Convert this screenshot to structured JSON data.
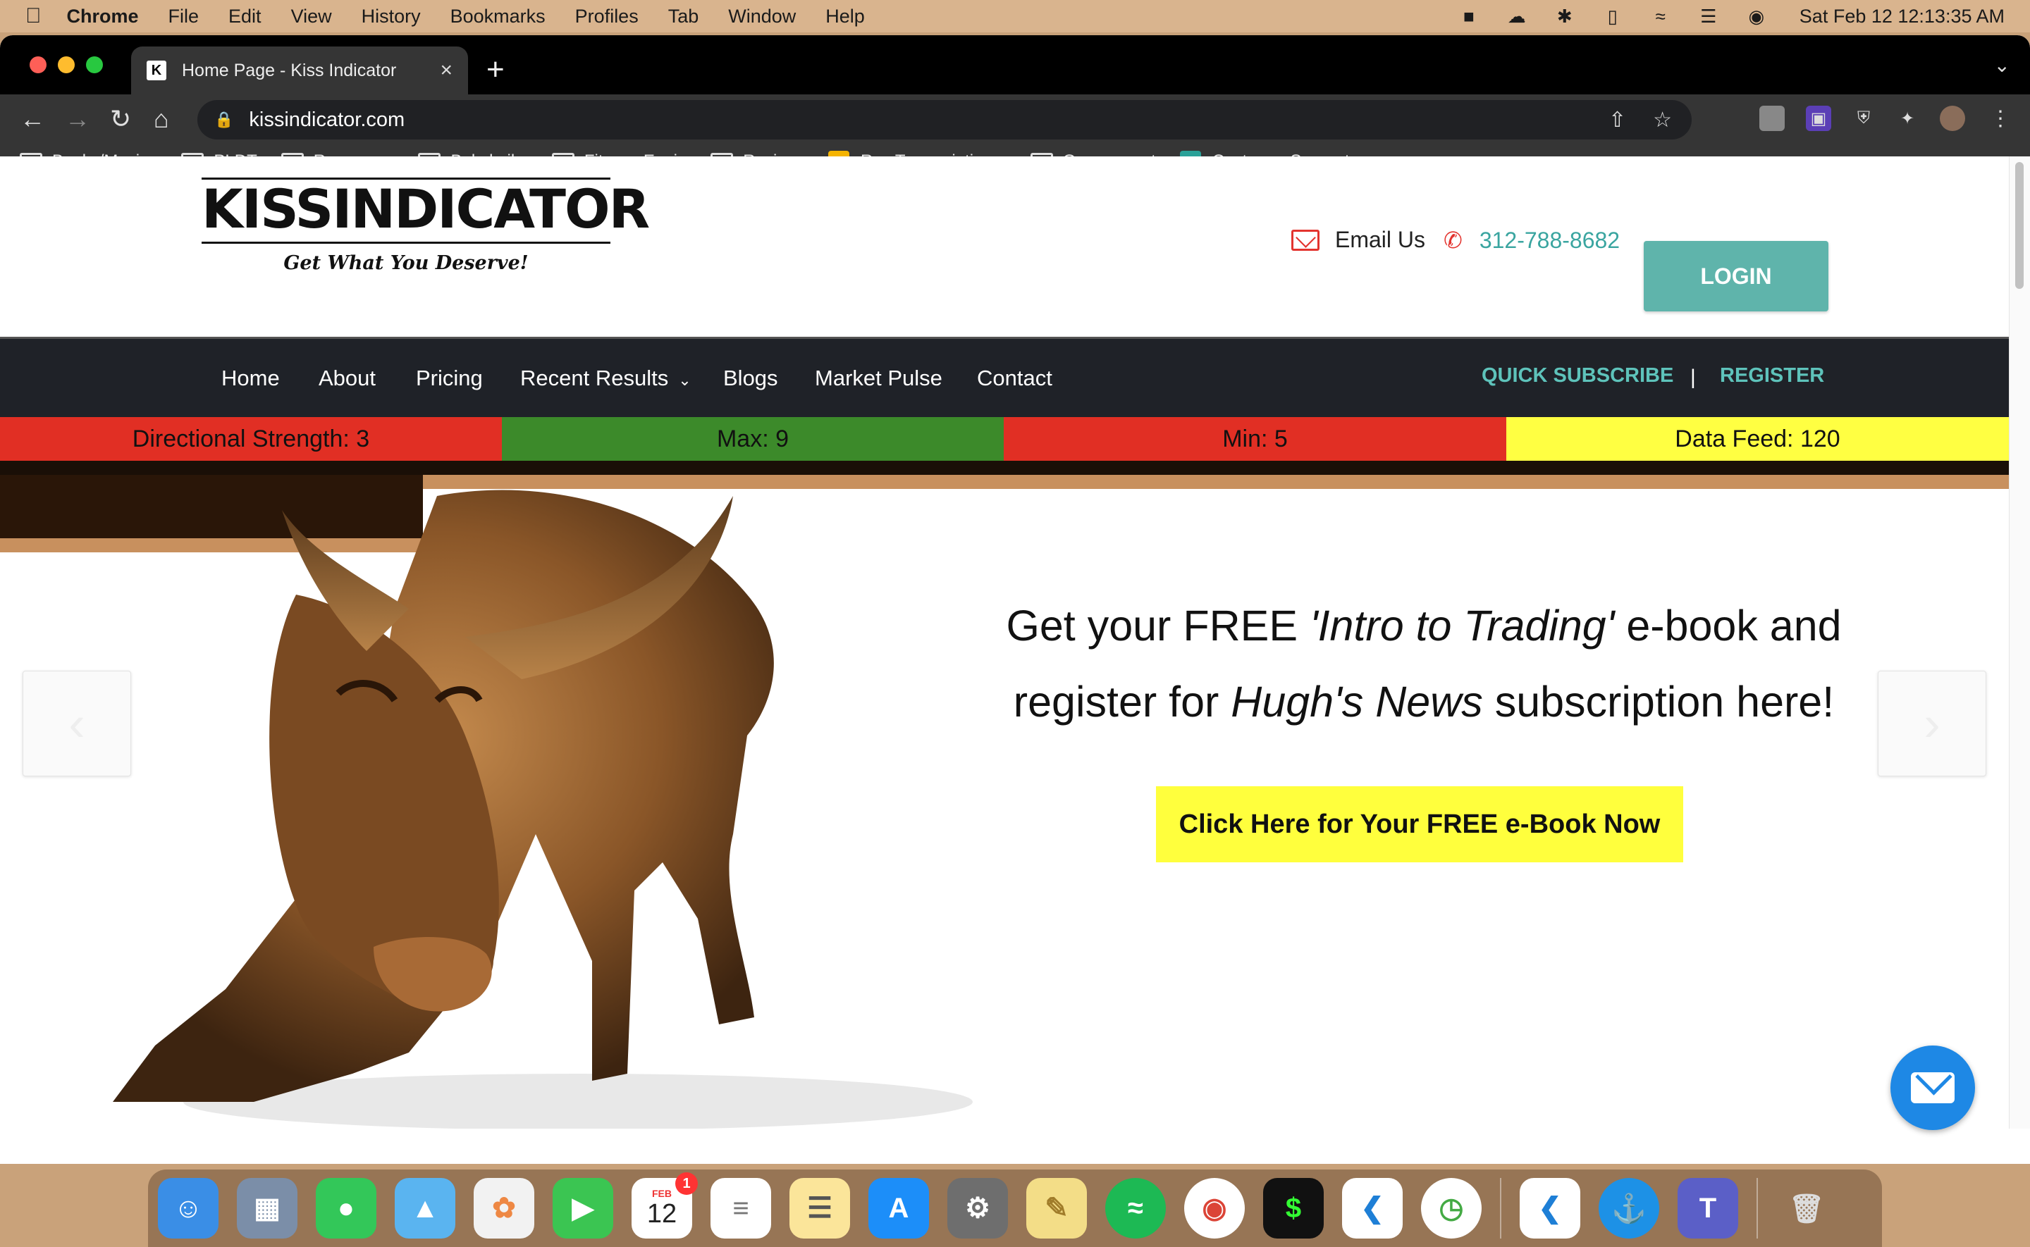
{
  "menubar": {
    "app_name": "Chrome",
    "items": [
      "File",
      "Edit",
      "View",
      "History",
      "Bookmarks",
      "Profiles",
      "Tab",
      "Window",
      "Help"
    ],
    "clock": "Sat Feb 12  12:13:35 AM"
  },
  "browser": {
    "tab_title": "Home Page - Kiss Indicator",
    "favicon_letter": "K",
    "url": "kissindicator.com",
    "bookmarks": [
      {
        "label": "Books/Movies",
        "icon": "folder-icon"
      },
      {
        "label": "PLDT",
        "icon": "folder-icon"
      },
      {
        "label": "Resources",
        "icon": "folder-icon"
      },
      {
        "label": "Babykeiks",
        "icon": "folder-icon"
      },
      {
        "label": "Fitness Equip",
        "icon": "folder-icon"
      },
      {
        "label": "Recipes",
        "icon": "folder-icon"
      },
      {
        "label": "Rev Transcription...",
        "icon": "rev-icon"
      },
      {
        "label": "Government",
        "icon": "folder-icon"
      },
      {
        "label": "Customer Support...",
        "icon": "support-icon"
      }
    ]
  },
  "site": {
    "logo_word": "KISSINDICATOR",
    "logo_tagline": "Get What You Deserve!",
    "email_label": "Email Us",
    "phone": "312-788-8682",
    "login_label": "LOGIN",
    "nav": {
      "home": "Home",
      "about": "About",
      "pricing": "Pricing",
      "recent_results": "Recent Results",
      "blogs": "Blogs",
      "market_pulse": "Market Pulse",
      "contact": "Contact",
      "quick_subscribe": "QUICK SUBSCRIBE",
      "separator": "|",
      "register": "REGISTER"
    },
    "ticker": {
      "directional": "Directional Strength: 3",
      "max": "Max: 9",
      "min": "Min: 5",
      "data_feed": "Data Feed: 120"
    },
    "hero": {
      "line1_prefix": "Get your FREE ",
      "line1_italic": "'Intro to Trading'",
      "line1_suffix": " e-book and",
      "line2_prefix": "register for ",
      "line2_italic": "Hugh's News",
      "line2_suffix": " subscription here!",
      "cta": "Click Here for Your FREE e-Book Now"
    },
    "colors": {
      "accent_teal": "#5fb4ab",
      "ticker_red": "#e12f24",
      "ticker_green": "#3c8a2a",
      "ticker_yellow": "#ffff42",
      "cta_yellow": "#ffff3d",
      "nav_bg": "#1f2228"
    }
  },
  "dock": {
    "calendar_month": "FEB",
    "calendar_day": "12",
    "calendar_badge": "1"
  }
}
